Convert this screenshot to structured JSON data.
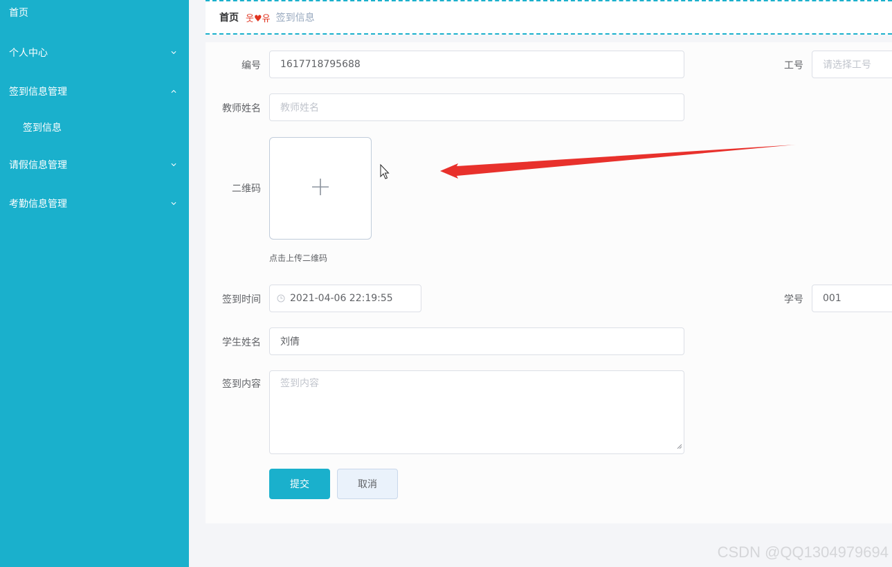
{
  "sidebar": {
    "items": [
      {
        "label": "首页"
      },
      {
        "label": "个人中心"
      },
      {
        "label": "签到信息管理"
      },
      {
        "label": "签到信息"
      },
      {
        "label": "请假信息管理"
      },
      {
        "label": "考勤信息管理"
      }
    ]
  },
  "breadcrumb": {
    "home": "首页",
    "separator_left": "웃",
    "separator_heart": "♥",
    "separator_right": "유",
    "current": "签到信息"
  },
  "form": {
    "id_label": "编号",
    "id_value": "1617718795688",
    "work_no_label": "工号",
    "work_no_placeholder": "请选择工号",
    "teacher_name_label": "教师姓名",
    "teacher_name_placeholder": "教师姓名",
    "qrcode_label": "二维码",
    "upload_tip": "点击上传二维码",
    "checkin_time_label": "签到时间",
    "checkin_time_value": "2021-04-06 22:19:55",
    "student_no_label": "学号",
    "student_no_value": "001",
    "student_name_label": "学生姓名",
    "student_name_value": "刘倩",
    "content_label": "签到内容",
    "content_placeholder": "签到内容",
    "submit_label": "提交",
    "cancel_label": "取消"
  },
  "watermark": "CSDN @QQ1304979694",
  "icons": {
    "chevron": "chevron-icon",
    "clock": "clock-icon",
    "plus": "plus-icon",
    "cursor": "mouse-cursor-icon",
    "arrow": "red-arrow-annotation"
  },
  "colors": {
    "sidebar_bg": "#1ab0cc",
    "accent": "#1ab0cc",
    "annotation": "#e8312c"
  }
}
